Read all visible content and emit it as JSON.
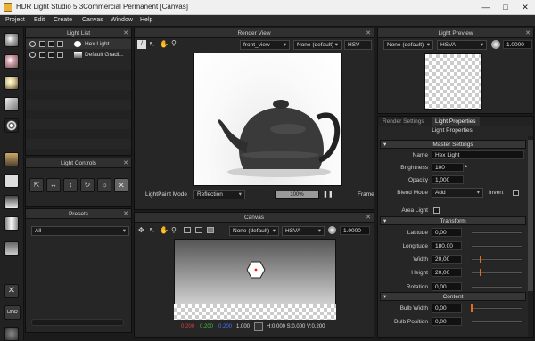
{
  "window": {
    "title": "HDR Light Studio 5.3Commercial Permanent [Canvas]"
  },
  "menu": [
    "Project",
    "Edit",
    "Create",
    "Canvas",
    "Window",
    "Help"
  ],
  "light_list": {
    "title": "Light List",
    "items": [
      {
        "name": "Hex Light"
      },
      {
        "name": "Default Gradi..."
      }
    ]
  },
  "light_controls": {
    "title": "Light Controls"
  },
  "presets": {
    "title": "Presets",
    "filter": "All"
  },
  "render_view": {
    "title": "Render View",
    "camera": "front_view",
    "layer": "None (default)",
    "colorspace": "HSV",
    "paint_mode_label": "LightPaint Mode",
    "paint_mode": "Reflection",
    "progress_label": "100%",
    "progress": 1.0,
    "frame_label": "Frame"
  },
  "canvas": {
    "title": "Canvas",
    "layer": "None (default)",
    "colorspace": "HSVA",
    "exposure": "1.0000",
    "status": {
      "r": "0.200",
      "g": "0.200",
      "b": "0.200",
      "a": "1.000",
      "hsv": "H:0.000 S:0.000 V:0.200"
    }
  },
  "light_preview": {
    "title": "Light Preview",
    "layer": "None (default)",
    "colorspace": "HSVA",
    "exposure": "1.0000"
  },
  "properties": {
    "tabs": [
      "Render Settings",
      "Light Properties"
    ],
    "header": "Light Properties",
    "master_title": "Master Settings",
    "name_label": "Name",
    "name_value": "Hex Light",
    "brightness_label": "Brightness",
    "brightness": "100",
    "opacity_label": "Opacity",
    "opacity": "1,000",
    "blend_label": "Blend Mode",
    "blend": "Add",
    "invert_label": "Invert",
    "area_light_label": "Area Light",
    "transform_title": "Transform",
    "latitude_label": "Latitude",
    "latitude": "0,00",
    "longitude_label": "Longitude",
    "longitude": "180,00",
    "width_label": "Width",
    "width": "20,00",
    "height_label": "Height",
    "height": "20,00",
    "rotation_label": "Rotation",
    "rotation": "0,00",
    "content_title": "Content",
    "bulb_width_label": "Bulb Width",
    "bulb_width": "0,00",
    "bulb_position_label": "Bulb Position",
    "bulb_position": "0,00"
  },
  "sidebar": {
    "hdr_label": "HDR"
  },
  "colors": {
    "accent": "#e07020",
    "panel": "#262626"
  }
}
